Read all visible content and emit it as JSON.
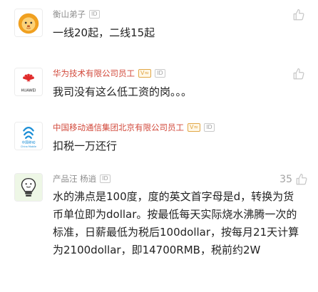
{
  "comments": [
    {
      "username": "衡山弟子",
      "badges": [
        "ID"
      ],
      "text": "一线20起，二线15起",
      "avatar_icon": "cartoon-lion-avatar-icon",
      "likes": ""
    },
    {
      "username": "华为技术有限公司员工",
      "badges": [
        "V≈",
        "ID"
      ],
      "text": "我司没有这么低工资的岗。。。",
      "avatar_icon": "huawei-logo-icon",
      "avatar_caption": "HUAWEI",
      "likes": ""
    },
    {
      "username": "中国移动通信集团北京有限公司员工",
      "badges": [
        "V≈",
        "ID"
      ],
      "text": "扣税一万还行",
      "avatar_icon": "china-mobile-logo-icon",
      "avatar_caption": "中国移动",
      "avatar_caption2": "China Mobile",
      "likes": ""
    },
    {
      "username": "产品汪 杨逍",
      "badges": [
        "ID"
      ],
      "text": "水的沸点是100度，度的英文首字母是d，转换为货币单位即为dollar。按最低每天实际烧水沸腾一次的标准，日薪最低为税后100dollar，按每月21天计算为2100dollar，即14700RMB，税前约2W",
      "avatar_icon": "lightbulb-avatar-icon",
      "likes": "35"
    }
  ],
  "colors": {
    "company_name": "#d24a3c",
    "username": "#8d8d8d",
    "text": "#222222"
  }
}
